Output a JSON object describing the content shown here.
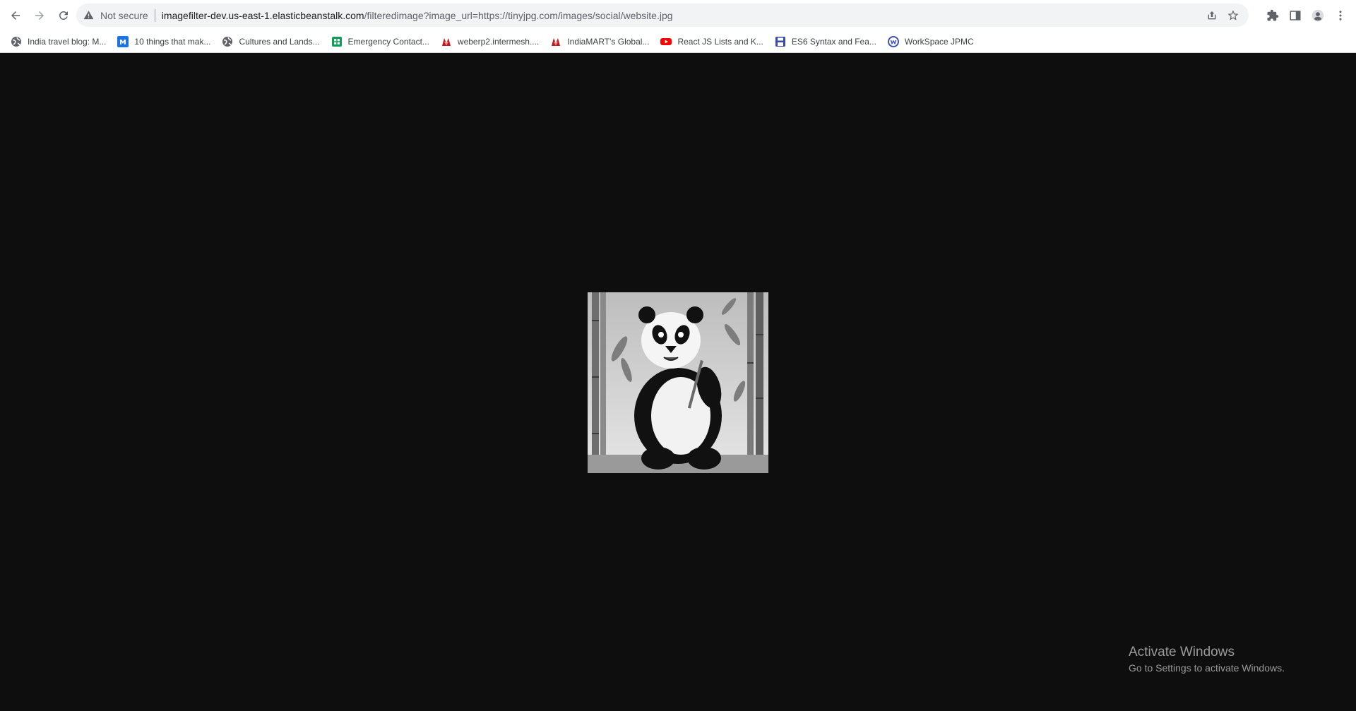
{
  "browser": {
    "not_secure_label": "Not secure",
    "url_host": "imagefilter-dev.us-east-1.elasticbeanstalk.com",
    "url_rest": "/filteredimage?image_url=https://tinyjpg.com/images/social/website.jpg"
  },
  "bookmarks": [
    {
      "label": "India travel blog: M...",
      "icon": "globe-icon",
      "color": "#5f6368"
    },
    {
      "label": "10 things that mak...",
      "icon": "m-logo-icon",
      "color": "#1a73e8"
    },
    {
      "label": "Cultures and Lands...",
      "icon": "globe-icon",
      "color": "#5f6368"
    },
    {
      "label": "Emergency Contact...",
      "icon": "sheets-icon",
      "color": "#0f9d58"
    },
    {
      "label": "weberp2.intermesh....",
      "icon": "indiamart-icon",
      "color": "#c4161c"
    },
    {
      "label": "IndiaMART's Global...",
      "icon": "indiamart-icon",
      "color": "#c4161c"
    },
    {
      "label": "React JS Lists and K...",
      "icon": "youtube-icon",
      "color": "#ff0000"
    },
    {
      "label": "ES6 Syntax and Fea...",
      "icon": "save-icon",
      "color": "#3949ab"
    },
    {
      "label": "WorkSpace JPMC",
      "icon": "workspace-icon",
      "color": "#3f51b5"
    }
  ],
  "watermark": {
    "title": "Activate Windows",
    "subtitle": "Go to Settings to activate Windows."
  },
  "colors": {
    "page_background": "#0e0e0e",
    "toolbar": "#ffffff",
    "omnibox": "#f1f3f4"
  }
}
